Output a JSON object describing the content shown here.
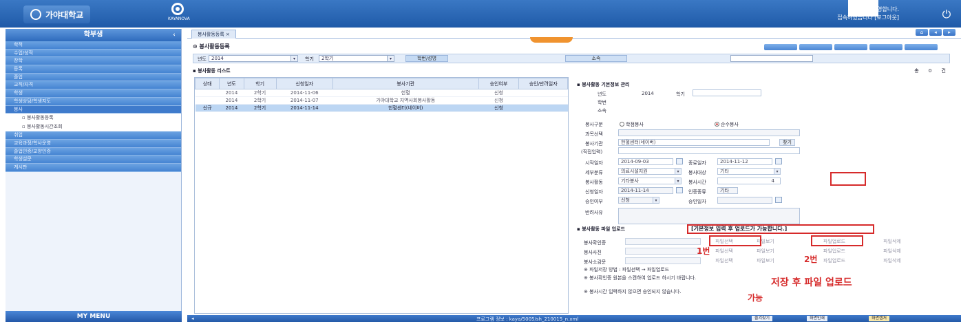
{
  "header": {
    "brand": "가야대학교",
    "system_logo_caption": "KAYANOVA",
    "user_line1": "환영합니다.",
    "user_line2": "접속하였습니다 [로그아웃]",
    "logout_icon": "power-icon"
  },
  "sidebar": {
    "title": "학부생",
    "items": [
      {
        "label": "학적"
      },
      {
        "label": "수업/성적"
      },
      {
        "label": "장학"
      },
      {
        "label": "등록"
      },
      {
        "label": "졸업"
      },
      {
        "label": "교직/자격"
      },
      {
        "label": "학생"
      },
      {
        "label": "학생상담/학생지도"
      },
      {
        "label": "봉사",
        "open": true
      }
    ],
    "sub_items": [
      {
        "label": "봉사활동등록"
      },
      {
        "label": "봉사활동시간조회"
      }
    ],
    "items_after": [
      {
        "label": "취업"
      },
      {
        "label": "교육과정/학사운영"
      },
      {
        "label": "졸업인증/교양인증"
      },
      {
        "label": "학생설문"
      },
      {
        "label": "게시판"
      }
    ],
    "my_menu": "MY MENU"
  },
  "main": {
    "tab_label": "봉사활동등록",
    "page_title": "봉사활동등록",
    "filter": {
      "year_label": "년도",
      "year_value": "2014",
      "term_label": "학기",
      "term_value": "2학기",
      "search_button": "학번/성명",
      "dept_label": "소속"
    },
    "list": {
      "title": "봉사활동 리스트",
      "pager": "총 0 건",
      "headers": [
        "상태",
        "년도",
        "학기",
        "신청일자",
        "봉사기관",
        "승인여부",
        "승인/반려일자"
      ],
      "rows": [
        {
          "status": "",
          "year": "2014",
          "term": "2학기",
          "date": "2014-11-06",
          "org": "헌혈",
          "approve": "신청",
          "approve_date": "",
          "selected": false
        },
        {
          "status": "",
          "year": "2014",
          "term": "2학기",
          "date": "2014-11-07",
          "org": "가야대학교 지역사회봉사활동",
          "approve": "신청",
          "approve_date": "",
          "selected": false
        },
        {
          "status": "신규",
          "year": "2014",
          "term": "2학기",
          "date": "2014-11-14",
          "org": "헌혈센터(네이버)",
          "approve": "신청",
          "approve_date": "",
          "selected": true
        }
      ]
    },
    "detail": {
      "title": "봉사활동 기본정보 관리",
      "year_label": "년도",
      "year_value": "2014",
      "term_label": "학기",
      "student_no_label": "학번",
      "dept_label": "소속",
      "type_label": "봉사구분",
      "type_opt1": "학점봉사",
      "type_opt2": "순수봉사",
      "subject_label": "과목선택",
      "org_label": "봉사기관",
      "org_value": "헌혈센터(네이버)",
      "org_button": "찾기",
      "direct_label": "(직접입력)",
      "start_label": "시작일자",
      "start_value": "2014-09-03",
      "end_label": "종료일자",
      "end_value": "2014-11-12",
      "category_label": "세부분류",
      "category_value": "의료시설지원",
      "target_label": "봉사대상",
      "target_value": "기타",
      "activity_label": "봉사활동",
      "activity_value": "기타봉사",
      "hours_label": "봉사시간",
      "hours_value": "4",
      "apply_label": "신청일자",
      "apply_value": "2014-11-14",
      "cert_label": "인증종류",
      "cert_value": "기타",
      "approve_label": "승인여부",
      "approve_value": "신청",
      "approve_date_label": "승인일자",
      "reject_label": "반려사유"
    },
    "files": {
      "title": "봉사활동 파일 업로드",
      "hint": "[기본정보 입력 후 업로드가 가능합니다.]",
      "row1_label": "봉사확인증",
      "row2_label": "봉사사진",
      "row3_label": "봉사소감문",
      "btn_select": "파일선택",
      "btn_upload": "파일업로드",
      "btn_view": "파일보기",
      "btn_delete": "파일삭제",
      "marker1": "1번",
      "marker2": "2번",
      "note1": "※ 파일저장 방법 : 파일선택 → 파일업로드",
      "note2": "※ 봉사확인증 원본을 스캔하여 업로드 하시기 바랍니다.",
      "note3": "※ 봉사시간 입력하지 않으면 승인되지 않습니다.",
      "annotation": "저장 후 파일 업로드",
      "annotation2": "가능"
    }
  },
  "statusbar": {
    "path": "프로그램 정보 : kaya/5005/sh_210015_n.xml",
    "btn1": "즐겨찾기",
    "btn2": "화면인쇄",
    "btn3": "화면캡처"
  }
}
